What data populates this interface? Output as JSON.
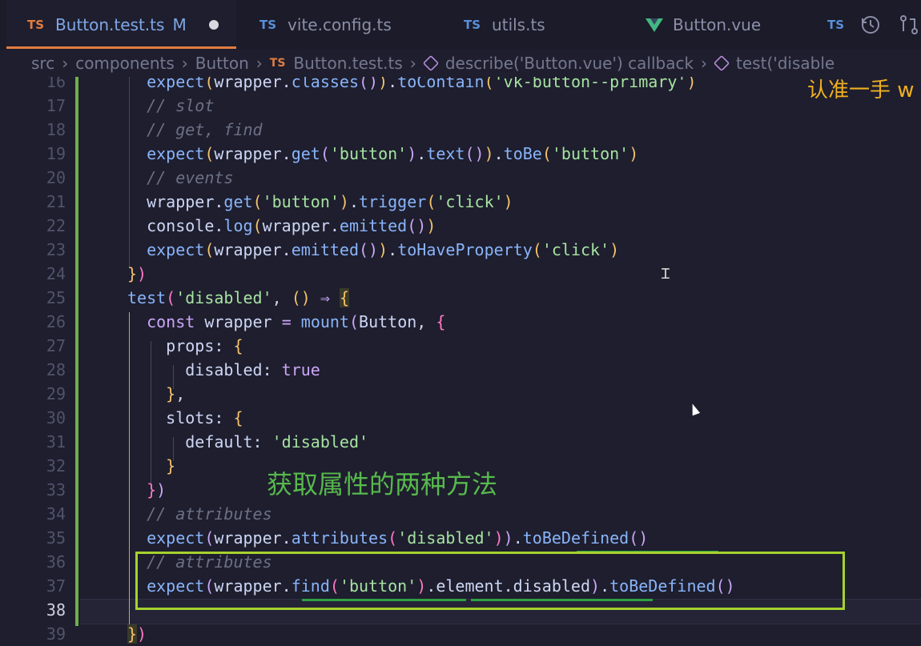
{
  "tabs": [
    {
      "badge": "TS",
      "name": "Button.test.ts",
      "modified": "M",
      "active": true
    },
    {
      "badge": "TS",
      "name": "vite.config.ts"
    },
    {
      "badge": "TS",
      "name": "utils.ts"
    },
    {
      "badge": "",
      "name": "Button.vue"
    },
    {
      "badge": "TS",
      "name": ""
    }
  ],
  "toolbar": {
    "history_icon": "history-icon",
    "compare_icon": "compare-icon"
  },
  "breadcrumb": [
    "src",
    "components",
    "Button",
    "Button.test.ts",
    "describe('Button.vue') callback",
    "test('disable"
  ],
  "breadcrumb_badge": "TS",
  "overlay": {
    "top_text": "认准一手 w",
    "center_text": "获取属性的两种方法"
  },
  "lines": [
    {
      "n": "16",
      "t": "  expect(wrapper.classes()).toContain('vk-button--primary')"
    },
    {
      "n": "17",
      "t": "  // slot"
    },
    {
      "n": "18",
      "t": "  // get, find"
    },
    {
      "n": "19",
      "t": "  expect(wrapper.get('button').text()).toBe('button')"
    },
    {
      "n": "20",
      "t": "  // events"
    },
    {
      "n": "21",
      "t": "  wrapper.get('button').trigger('click')"
    },
    {
      "n": "22",
      "t": "  console.log(wrapper.emitted())"
    },
    {
      "n": "23",
      "t": "  expect(wrapper.emitted()).toHaveProperty('click')"
    },
    {
      "n": "24",
      "t": "})"
    },
    {
      "n": "25",
      "t": "test('disabled', () ⇒ {"
    },
    {
      "n": "26",
      "t": "  const wrapper = mount(Button, {"
    },
    {
      "n": "27",
      "t": "    props: {"
    },
    {
      "n": "28",
      "t": "      disabled: true"
    },
    {
      "n": "29",
      "t": "    },"
    },
    {
      "n": "30",
      "t": "    slots: {"
    },
    {
      "n": "31",
      "t": "      default: 'disabled'"
    },
    {
      "n": "32",
      "t": "    }"
    },
    {
      "n": "33",
      "t": "  })"
    },
    {
      "n": "34",
      "t": "  // attributes"
    },
    {
      "n": "35",
      "t": "  expect(wrapper.attributes('disabled')).toBeDefined()"
    },
    {
      "n": "36",
      "t": "  // attributes"
    },
    {
      "n": "37",
      "t": "  expect(wrapper.find('button').element.disabled).toBeDefined()"
    },
    {
      "n": "38",
      "t": ""
    },
    {
      "n": "39",
      "t": "})"
    }
  ],
  "colors": {
    "accent": "#e27d40",
    "highlight_box": "#a6d22e",
    "overlay_green": "#57b94c",
    "overlay_orange": "#f0b020"
  }
}
